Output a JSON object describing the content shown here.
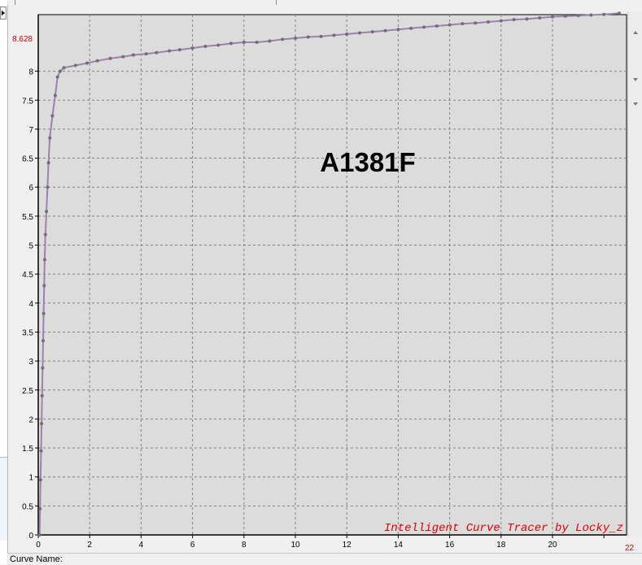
{
  "chart_data": {
    "type": "line",
    "title": "A1381F",
    "watermark": "Intelligent Curve Tracer by Locky_z",
    "xlabel": "",
    "ylabel": "",
    "xlim": [
      0,
      22
    ],
    "ylim": [
      0,
      8.628
    ],
    "x_ticks": [
      0,
      2,
      4,
      6,
      8,
      10,
      12,
      14,
      16,
      18,
      20,
      22
    ],
    "y_ticks": [
      0,
      0.5,
      1,
      1.5,
      2,
      2.5,
      3,
      3.5,
      4,
      4.5,
      5,
      5.5,
      6,
      6.5,
      7,
      7.5,
      8
    ],
    "x_max_label": "22",
    "y_max_label": "8.628",
    "grid": true,
    "colors": {
      "line": "#a07fb3",
      "marker": "#707070",
      "grid": "#808080",
      "background": "#dcdcdc",
      "watermark": "#e00000",
      "max_label": "#e00000"
    },
    "series": [
      {
        "x": [
          0.05,
          0.07,
          0.09,
          0.11,
          0.13,
          0.15,
          0.17,
          0.19,
          0.21,
          0.23,
          0.25,
          0.28,
          0.32,
          0.36,
          0.4,
          0.45,
          0.55,
          0.66,
          0.75,
          0.85,
          1.0,
          1.45,
          1.9,
          2.3,
          2.8,
          3.3,
          3.7,
          4.2,
          4.6,
          5.1,
          5.5,
          6.0,
          6.5,
          7.0,
          7.5,
          8.0,
          8.5,
          9.0,
          9.5,
          10.0,
          10.5,
          11.0,
          11.5,
          12.0,
          12.5,
          13.0,
          13.5,
          14.0,
          14.5,
          15.0,
          15.5,
          16.0,
          16.5,
          17.0,
          17.5,
          18.0,
          18.5,
          19.0,
          19.5,
          20.0,
          20.5,
          21.0,
          21.5,
          22.0,
          22.6
        ],
        "y": [
          0,
          0.45,
          0.95,
          1.45,
          1.92,
          2.4,
          2.88,
          3.35,
          3.82,
          4.3,
          4.75,
          5.18,
          5.58,
          6.0,
          6.42,
          6.85,
          7.23,
          7.58,
          7.9,
          8.0,
          8.06,
          8.1,
          8.14,
          8.18,
          8.22,
          8.25,
          8.28,
          8.3,
          8.32,
          8.35,
          8.37,
          8.4,
          8.43,
          8.45,
          8.48,
          8.5,
          8.5,
          8.52,
          8.55,
          8.57,
          8.59,
          8.6,
          8.62,
          8.64,
          8.66,
          8.68,
          8.7,
          8.72,
          8.74,
          8.76,
          8.78,
          8.8,
          8.82,
          8.83,
          8.85,
          8.87,
          8.89,
          8.9,
          8.92,
          8.94,
          8.95,
          8.96,
          8.97,
          8.98,
          9.0
        ]
      }
    ]
  },
  "status_bar": {
    "label": "Curve Name:"
  }
}
